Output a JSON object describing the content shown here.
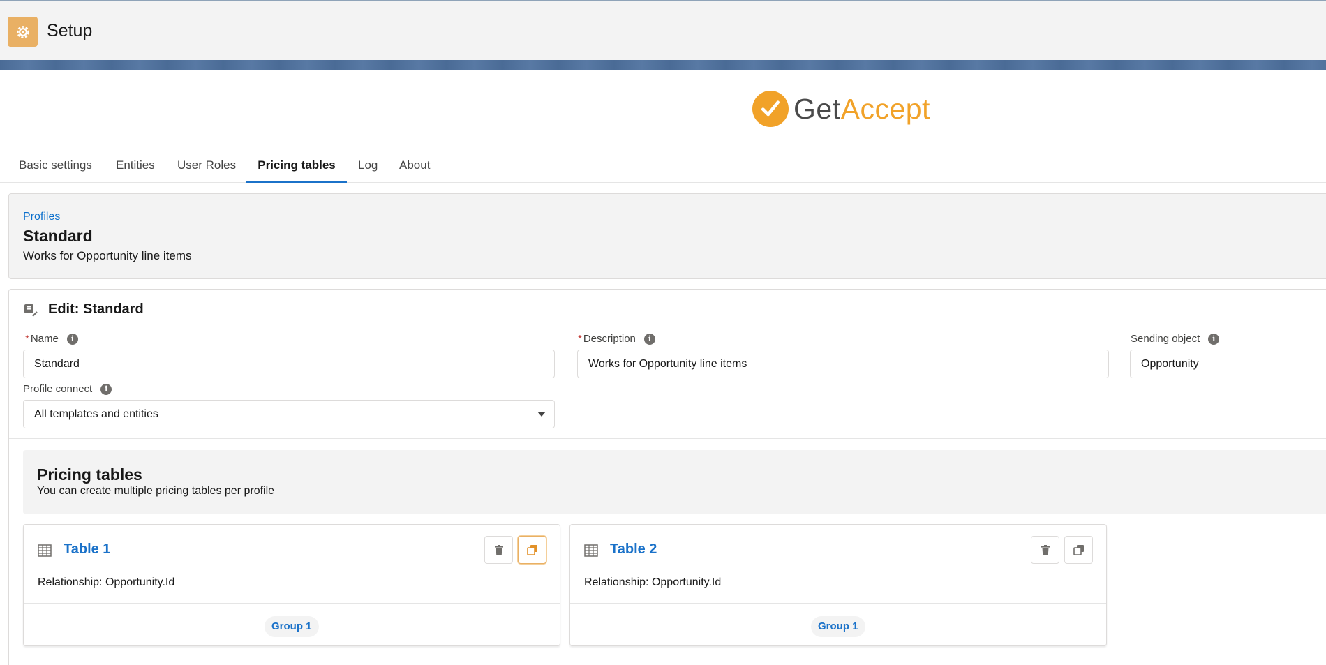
{
  "app": {
    "title": "Setup"
  },
  "logo": {
    "part1": "Get",
    "part2": "Accept"
  },
  "tabs": [
    {
      "label": "Basic settings"
    },
    {
      "label": "Entities"
    },
    {
      "label": "User Roles"
    },
    {
      "label": "Pricing tables",
      "active": true
    },
    {
      "label": "Log"
    },
    {
      "label": "About"
    }
  ],
  "profile": {
    "breadcrumb": "Profiles",
    "name": "Standard",
    "description": "Works for Opportunity line items"
  },
  "edit": {
    "title": "Edit: Standard",
    "fields": {
      "name": {
        "label": "Name",
        "value": "Standard"
      },
      "description": {
        "label": "Description",
        "value": "Works for Opportunity line items"
      },
      "sending_object": {
        "label": "Sending object",
        "value": "Opportunity"
      },
      "profile_connect": {
        "label": "Profile connect",
        "value": "All templates and entities"
      }
    }
  },
  "pricing_tables": {
    "title": "Pricing tables",
    "subtitle": "You can create multiple pricing tables per profile",
    "tables": [
      {
        "title": "Table 1",
        "relationship": "Relationship: Opportunity.Id",
        "group": "Group 1"
      },
      {
        "title": "Table 2",
        "relationship": "Relationship: Opportunity.Id",
        "group": "Group 1"
      }
    ]
  },
  "colors": {
    "accent": "#1b72c9",
    "brand_orange": "#f1a229",
    "required": "#c23934"
  }
}
